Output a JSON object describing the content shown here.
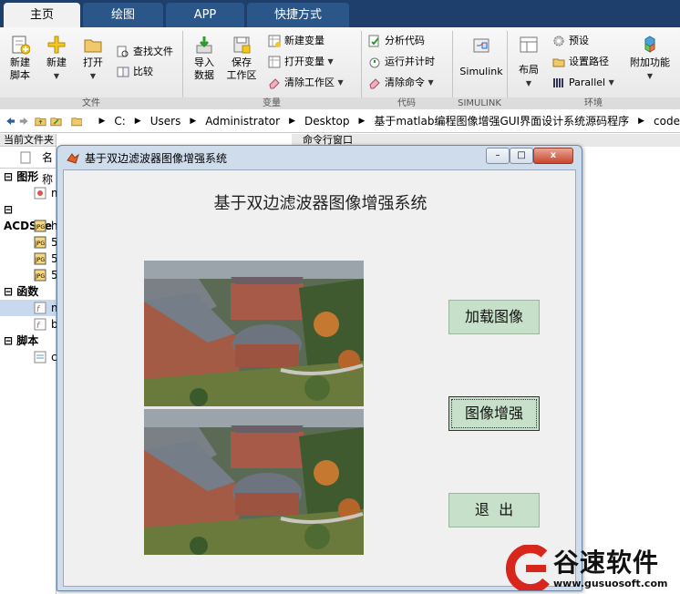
{
  "tabs": [
    "主页",
    "绘图",
    "APP",
    "快捷方式"
  ],
  "ribbon": {
    "file": {
      "new_script": "新建\n脚本",
      "new": "新建",
      "open": "打开",
      "find_files": "查找文件",
      "compare": "比较",
      "group": "文件"
    },
    "variable": {
      "import": "导入\n数据",
      "save_ws": "保存\n工作区",
      "new_var": "新建变量",
      "open_var": "打开变量",
      "clear_ws": "清除工作区",
      "group": "变量"
    },
    "code": {
      "analyze": "分析代码",
      "run_time": "运行并计时",
      "clear_cmd": "清除命令",
      "group": "代码"
    },
    "simulink": {
      "label": "Simulink",
      "group": "SIMULINK"
    },
    "env": {
      "layout": "布局",
      "prefs": "预设",
      "set_path": "设置路径",
      "parallel": "Parallel",
      "addons": "附加功能",
      "group": "环境"
    }
  },
  "address": {
    "path": [
      "C:",
      "Users",
      "Administrator",
      "Desktop",
      "基于matlab编程图像增强GUI界面设计系统源码程序",
      "code"
    ]
  },
  "left_panel": {
    "title": "当前文件夹",
    "col_name": "名称",
    "groups": [
      {
        "label": "图形",
        "items": [
          "m"
        ]
      },
      {
        "label": "ACDSee",
        "items": [
          "h",
          "5",
          "5",
          "5"
        ]
      },
      {
        "label": "函数",
        "items": [
          "m",
          "b"
        ]
      },
      {
        "label": "脚本",
        "items": [
          "c"
        ]
      }
    ]
  },
  "command_window": {
    "title": "命令行窗口"
  },
  "dialog": {
    "title": "基于双边滤波器图像增强系统",
    "heading": "基于双边滤波器图像增强系统",
    "buttons": {
      "load": "加载图像",
      "enhance": "图像增强",
      "exit": "退  出"
    },
    "window_controls": {
      "minimize": "–",
      "maximize": "□",
      "close": "x"
    }
  },
  "watermark": {
    "brand": "谷速软件",
    "url": "www.gusuosoft.com"
  },
  "colors": {
    "tabbar": "#1e3f6b",
    "button_green": "#c7e0c9",
    "watermark_red": "#d8261c"
  }
}
